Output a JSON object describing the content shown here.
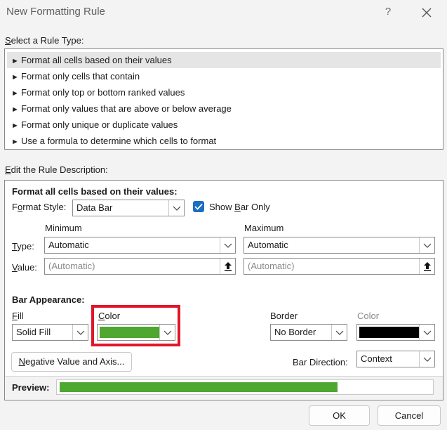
{
  "window": {
    "title": "New Formatting Rule",
    "help": "?"
  },
  "rule_type": {
    "label_mnemonic": "S",
    "label_rest": "elect a Rule Type:",
    "items": [
      {
        "label": "Format all cells based on their values",
        "selected": true
      },
      {
        "label": "Format only cells that contain",
        "selected": false
      },
      {
        "label": "Format only top or bottom ranked values",
        "selected": false
      },
      {
        "label": "Format only values that are above or below average",
        "selected": false
      },
      {
        "label": "Format only unique or duplicate values",
        "selected": false
      },
      {
        "label": "Use a formula to determine which cells to format",
        "selected": false
      }
    ]
  },
  "description": {
    "label_mnemonic": "E",
    "label_rest": "dit the Rule Description:",
    "heading": "Format all cells based on their values:",
    "format_style_pre": "F",
    "format_style_mn": "o",
    "format_style_post": "rmat Style:",
    "format_style_value": "Data Bar",
    "show_bar_pre": "Show ",
    "show_bar_mn": "B",
    "show_bar_post": "ar Only",
    "show_bar_checked": true,
    "minimum_label": "Minimum",
    "maximum_label": "Maximum",
    "type_mn": "T",
    "type_rest": "ype:",
    "value_mn": "V",
    "value_rest": "alue:",
    "min_type": "Automatic",
    "max_type": "Automatic",
    "min_value_placeholder": "(Automatic)",
    "max_value_placeholder": "(Automatic)",
    "bar_appearance": "Bar Appearance:",
    "fill_mn": "F",
    "fill_rest": "ill",
    "fill_value": "Solid Fill",
    "color_mn": "C",
    "color_rest": "olor",
    "fill_color": "#4EA72E",
    "border_label": "Border",
    "border_value": "No Border",
    "border_color_label": "Color",
    "border_color": "#000000",
    "negative_mn": "N",
    "negative_rest": "egative Value and Axis...",
    "bar_direction_label": "Bar Direction:",
    "bar_direction_value": "Context",
    "preview_label": "Preview:",
    "preview_fill_fraction": 0.75
  },
  "buttons": {
    "ok": "OK",
    "cancel": "Cancel"
  },
  "colors": {
    "highlight_box": "#E0162B",
    "checkbox": "#1A6FC2"
  }
}
